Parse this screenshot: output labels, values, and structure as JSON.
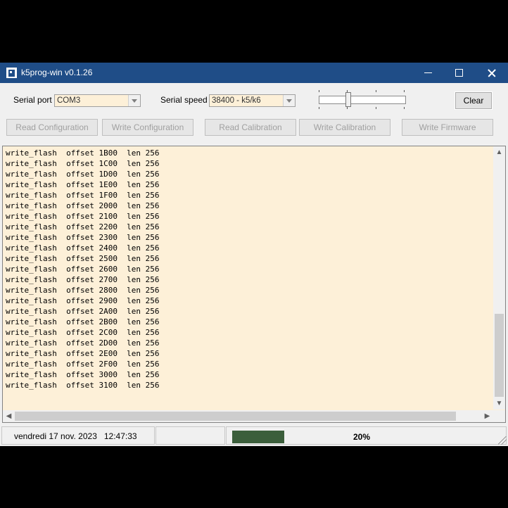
{
  "window": {
    "title": "k5prog-win v0.1.26"
  },
  "serial": {
    "port_label": "Serial port",
    "port_value": "COM3",
    "speed_label": "Serial speed",
    "speed_value": "38400 - k5/k6"
  },
  "toolbar": {
    "clear_label": "Clear",
    "read_config_label": "Read Configuration",
    "write_config_label": "Write Configuration",
    "read_calib_label": "Read Calibration",
    "write_calib_label": "Write Calibration",
    "write_firmware_label": "Write Firmware"
  },
  "log": {
    "lines": [
      "write_flash  offset 1B00  len 256",
      "write_flash  offset 1C00  len 256",
      "write_flash  offset 1D00  len 256",
      "write_flash  offset 1E00  len 256",
      "write_flash  offset 1F00  len 256",
      "write_flash  offset 2000  len 256",
      "write_flash  offset 2100  len 256",
      "write_flash  offset 2200  len 256",
      "write_flash  offset 2300  len 256",
      "write_flash  offset 2400  len 256",
      "write_flash  offset 2500  len 256",
      "write_flash  offset 2600  len 256",
      "write_flash  offset 2700  len 256",
      "write_flash  offset 2800  len 256",
      "write_flash  offset 2900  len 256",
      "write_flash  offset 2A00  len 256",
      "write_flash  offset 2B00  len 256",
      "write_flash  offset 2C00  len 256",
      "write_flash  offset 2D00  len 256",
      "write_flash  offset 2E00  len 256",
      "write_flash  offset 2F00  len 256",
      "write_flash  offset 3000  len 256",
      "write_flash  offset 3100  len 256"
    ]
  },
  "status": {
    "datetime": "vendredi 17 nov. 2023   12:47:33",
    "progress_percent_label": "20%",
    "progress_fraction": 0.2
  },
  "colors": {
    "titlebar": "#1f4d87",
    "log_background": "#fdf0d8",
    "progress_fill": "#3b5e3b"
  }
}
